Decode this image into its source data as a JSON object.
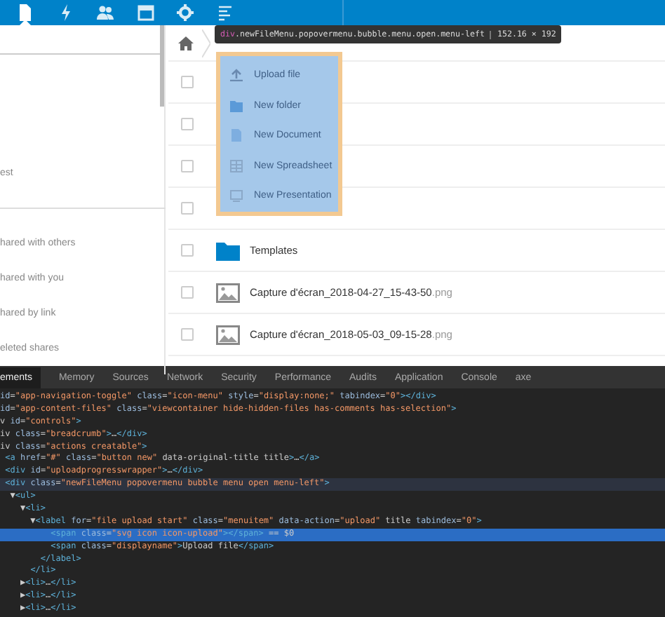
{
  "top_bar": {
    "apps": [
      {
        "kind": "files",
        "selected": true
      },
      {
        "kind": "activity",
        "selected": false
      },
      {
        "kind": "contacts",
        "selected": false
      },
      {
        "kind": "calendar",
        "selected": false
      },
      {
        "kind": "settings",
        "selected": false
      },
      {
        "kind": "list",
        "selected": false
      }
    ]
  },
  "sidebar": {
    "items": [
      {
        "label": "est"
      },
      {
        "label": "hared with others"
      },
      {
        "label": "hared with you"
      },
      {
        "label": "hared by link"
      },
      {
        "label": "eleted shares"
      }
    ]
  },
  "file_list": {
    "rows": [
      {
        "kind": "hidden",
        "checked": false
      },
      {
        "kind": "hidden",
        "checked": false
      },
      {
        "kind": "hidden",
        "checked": false
      },
      {
        "kind": "hidden",
        "checked": false
      },
      {
        "kind": "folder",
        "name": "Templates",
        "checked": false
      },
      {
        "kind": "image",
        "name": "Capture d'écran_2018-04-27_15-43-50",
        "extension": ".png",
        "checked": false
      },
      {
        "kind": "image",
        "name": "Capture d'écran_2018-05-03_09-15-28",
        "extension": ".png",
        "checked": false
      }
    ]
  },
  "new_file_menu": {
    "items": [
      {
        "kind": "upload",
        "label": "Upload file"
      },
      {
        "kind": "folder",
        "label": "New folder"
      },
      {
        "kind": "document",
        "label": "New Document"
      },
      {
        "kind": "spreadsheet",
        "label": "New Spreadsheet"
      },
      {
        "kind": "presentation",
        "label": "New Presentation"
      }
    ]
  },
  "inspect_tooltip": {
    "tag": "div",
    "classes": ".newFileMenu.popovermenu.bubble.menu.open.menu-left",
    "size": "152.16 × 192"
  },
  "devtools": {
    "tabs": [
      {
        "label": "ements",
        "selected": true
      },
      {
        "label": "Memory",
        "selected": false
      },
      {
        "label": "Sources",
        "selected": false
      },
      {
        "label": "Network",
        "selected": false
      },
      {
        "label": "Security",
        "selected": false
      },
      {
        "label": "Performance",
        "selected": false
      },
      {
        "label": "Audits",
        "selected": false
      },
      {
        "label": "Application",
        "selected": false
      },
      {
        "label": "Console",
        "selected": false
      },
      {
        "label": "axe",
        "selected": false
      }
    ],
    "lines": [
      {
        "text": "id=\"app-navigation-toggle\" class=\"icon-menu\" style=\"display:none;\" tabindex=\"0\"></div>",
        "selected": false
      },
      {
        "text": "id=\"app-content-files\" class=\"viewcontainer hide-hidden-files has-comments has-selection\">",
        "selected": false
      },
      {
        "text": "v id=\"controls\">",
        "selected": false
      },
      {
        "text": "iv class=\"breadcrumb\">…</div>",
        "selected": false
      },
      {
        "text": "iv class=\"actions creatable\">",
        "selected": false
      },
      {
        "text": " <a href=\"#\" class=\"button new\" data-original-title title>…</a>",
        "selected": false
      },
      {
        "text": " <div id=\"uploadprogresswrapper\">…</div>",
        "selected": false
      },
      {
        "text": " <div class=\"newFileMenu popovermenu bubble menu open menu-left\">",
        "selected": false
      },
      {
        "text": "  ▼<ul>",
        "selected": false
      },
      {
        "text": "    ▼<li>",
        "selected": false
      },
      {
        "text": "      ▼<label for=\"file upload start\" class=\"menuitem\" data-action=\"upload\" title tabindex=\"0\">",
        "selected": false
      },
      {
        "text": "          <span class=\"svg icon icon-upload\"></span> == $0",
        "selected": true
      },
      {
        "text": "          <span class=\"displayname\">Upload file</span>",
        "selected": false
      },
      {
        "text": "        </label>",
        "selected": false
      },
      {
        "text": "      </li>",
        "selected": false
      },
      {
        "text": "    ▶<li>…</li>",
        "selected": false
      },
      {
        "text": "    ▶<li>…</li>",
        "selected": false
      },
      {
        "text": "    ▶<li>…</li>",
        "selected": false
      }
    ]
  }
}
